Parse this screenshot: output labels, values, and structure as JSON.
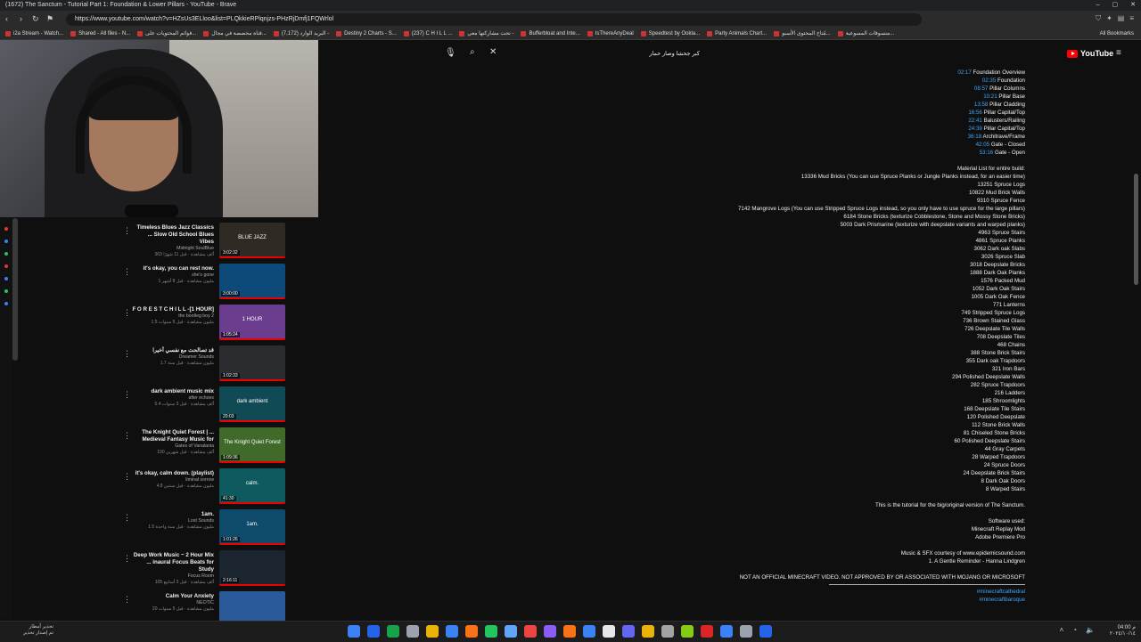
{
  "browser": {
    "window_title": "(1672) The Sanctum - Tutorial Part 1: Foundation & Lower Pillars - YouTube - Brave",
    "url": "https://www.youtube.com/watch?v=HZsUs3ELloo&list=PLQkkieRPlqnjzs-PHzRjDmfj1FQWrlol",
    "bookmarks": [
      "i2a Stream - Watch...",
      "Shared - All files - N...",
      "قوائم المحتويات على...",
      "قناة مخصصة في مجال...",
      "(7,172) البريد الوارد -",
      "Destiny 2 Charts - S...",
      "(237) C H I L L ...",
      "تحت مشاركتها معي -",
      "Bufferbloat and Inte...",
      "IsThereAnyDeal",
      "Speedtest by Ookla...",
      "Party Animals Chart...",
      "مُتاح المحتوى الأسبو...",
      "منسوقات المسوعية..."
    ],
    "all_bookmarks": "All Bookmarks"
  },
  "youtube": {
    "search_value": "كبر جحشا وصار حمار",
    "logo_text": "YouTube"
  },
  "playlist": [
    {
      "title": "Timeless Blues Jazz Classics ... Slow Old School Blues Vibes",
      "channel": "Midnight SoulBlue",
      "meta": "363 ألف مشاهدة · قبل 11 شهرًا",
      "duration": "3:02:32",
      "thumb_label": "BLUE JAZZ",
      "thumb_color": "#2f2a24"
    },
    {
      "title": "it's okay, you can rest now.",
      "channel": "she's gone",
      "meta": "1 مليون مشاهدة · قبل 8 أشهر",
      "duration": "3:00:00",
      "thumb_label": "",
      "thumb_color": "#0d4a7a"
    },
    {
      "title": "F O R E S T   C H I L L -[1 HOUR]",
      "channel": "the bootleg boy 2",
      "meta": "1.5 مليون مشاهدة · قبل 5 سنوات",
      "duration": "1:05:24",
      "thumb_label": "1 HOUR",
      "thumb_color": "#6a3d8f"
    },
    {
      "title": "قد تصالحت مع نفسي أخيرا",
      "channel": "Dreamer Sounds",
      "meta": "1.7 مليون مشاهدة · قبل سنة",
      "duration": "1:02:33",
      "thumb_label": "",
      "thumb_color": "#2a2c30"
    },
    {
      "title": "dark ambient music mix",
      "channel": "after echoes",
      "meta": "5.4 ألف مشاهدة · قبل 3 سنوات",
      "duration": "20:03",
      "thumb_label": "dark ambient",
      "thumb_color": "#0f4a55"
    },
    {
      "title": "The Knight Quiet Forest | ... Medieval Fantasy Music for",
      "channel": "Gates of Vanalania",
      "meta": "190 ألف مشاهدة · قبل شهرين",
      "duration": "1:09:36",
      "thumb_label": "The Knight Quiet Forest",
      "thumb_color": "#3f6a2a"
    },
    {
      "title": "it's okay, calm down. (playlist)",
      "channel": "liminal sorrow",
      "meta": "4.8 مليون مشاهدة · قبل سنتين",
      "duration": "41:30",
      "thumb_label": "calm.",
      "thumb_color": "#0f5a5e"
    },
    {
      "title": "1am.",
      "channel": "Lost Sounds",
      "meta": "1.5 مليون مشاهدة · قبل سنة واحدة",
      "duration": "1:01:26",
      "thumb_label": "1am.",
      "thumb_color": "#0e4a6a"
    },
    {
      "title": "Deep Work Music ~ 2 Hour Mix ... inaural Focus Beats for Study",
      "channel": "Focus Room",
      "meta": "105 ألف مشاهدة · قبل 3 أسابيع",
      "duration": "2:16:11",
      "thumb_label": "",
      "thumb_color": "#1a2530"
    },
    {
      "title": "Calm Your Anxiety",
      "channel": "NEOTIC",
      "meta": "20 مليون مشاهدة · قبل 5 سنوات",
      "duration": "",
      "thumb_label": "",
      "thumb_color": "#2a5a9a"
    }
  ],
  "description": {
    "chapters": [
      {
        "time": "02:17",
        "label": "Foundation Overview"
      },
      {
        "time": "02:35",
        "label": "Foundation"
      },
      {
        "time": "08:57",
        "label": "Pillar Columns"
      },
      {
        "time": "10:21",
        "label": "Pillar Base"
      },
      {
        "time": "13:58",
        "label": "Pillar Cladding"
      },
      {
        "time": "16:56",
        "label": "Pillar Capital/Top"
      },
      {
        "time": "22:41",
        "label": "Balusters/Railing"
      },
      {
        "time": "24:39",
        "label": "Pillar Capital/Top"
      },
      {
        "time": "36:18",
        "label": "Architrave/Frame"
      },
      {
        "time": "42:05",
        "label": "Gate - Closed"
      },
      {
        "time": "53:16",
        "label": "Gate - Open"
      }
    ],
    "material_header": "Material List for entire build:",
    "materials": [
      "13336 Mud Bricks (You can use Spruce Planks or Jungle Planks instead, for an easier time)",
      "13251 Spruce Logs",
      "10822 Mud Brick Walls",
      "9310 Spruce Fence",
      "7142 Mangrove Logs (You can use Stripped Spruce Logs instead, so you only have to use spruce for the large pillars)",
      "6184 Stone Bricks (texturize Cobblestone, Stone and Mossy Stone Bricks)",
      "5003 Dark Prismarine (texturize with deepslate variants and warped planks)",
      "4963 Spruce Stairs",
      "4861 Spruce Planks",
      "3062 Dark oak Slabs",
      "3026 Spruce Slab",
      "3018 Deepslate Bricks",
      "1888 Dark Oak Planks",
      "1576 Packed Mud",
      "1052 Dark Oak Stairs",
      "1005 Dark Oak Fence",
      "771 Lanterns",
      "749 Stripped Spruce Logs",
      "736 Brown Stained Glass",
      "726 Deepslate Tile Walls",
      "708 Deepslate Tiles",
      "468 Chains",
      "388 Stone Brick Stairs",
      "355 Dark oak Trapdoors",
      "321 Iron Bars",
      "294 Polished Deepslate Walls",
      "282 Spruce Trapdoors",
      "216 Ladders",
      "185 Shroomlights",
      "168 Deepslate Tile Stairs",
      "120 Polished Deepslate",
      "112 Stone Brick Walls",
      "81 Chiseled Stone Bricks",
      "60 Polished Deepslate Stairs",
      "44 Gray Carpets",
      "28 Warped Trapdoors",
      "24 Spruce Doors",
      "24 Deepslate Brick Stairs",
      "8 Dark Oak Doors",
      "8 Warped Stairs"
    ],
    "tutorial_note": "This is the tutorial for the big/original version of The Sanctum.",
    "software_header": "Software used:",
    "software": [
      "Minecraft Replay Mod",
      "Adobe Premiere Pro"
    ],
    "music_header": "Music & SFX courtesy of www.epidemicsound.com",
    "music_track": "1. A Gentle Reminder - Hanna Lindgren",
    "disclaimer": "NOT AN OFFICIAL MINECRAFT VIDEO. NOT APPROVED BY OR ASSOCIATED WITH MOJANG OR MICROSOFT",
    "hashtags": [
      "#minecraftcathedral",
      "#minecraftbaroque"
    ]
  },
  "taskbar": {
    "weather_line1": "تحذير أمطار",
    "weather_line2": "تم إصدار تحذير",
    "time": "م 04:00",
    "date": "٢٠٢٤/١٠/١٤",
    "app_colors": [
      "#3b82f6",
      "#2563eb",
      "#16a34a",
      "#9ca3af",
      "#eab308",
      "#3b82f6",
      "#f97316",
      "#22c55e",
      "#60a5fa",
      "#ef4444",
      "#8b5cf6",
      "#f97316",
      "#3b82f6",
      "#e5e7eb",
      "#6366f1",
      "#eab308",
      "#a3a3a3",
      "#84cc16",
      "#dc2626",
      "#3b82f6",
      "#9ca3af",
      "#2563eb"
    ]
  }
}
